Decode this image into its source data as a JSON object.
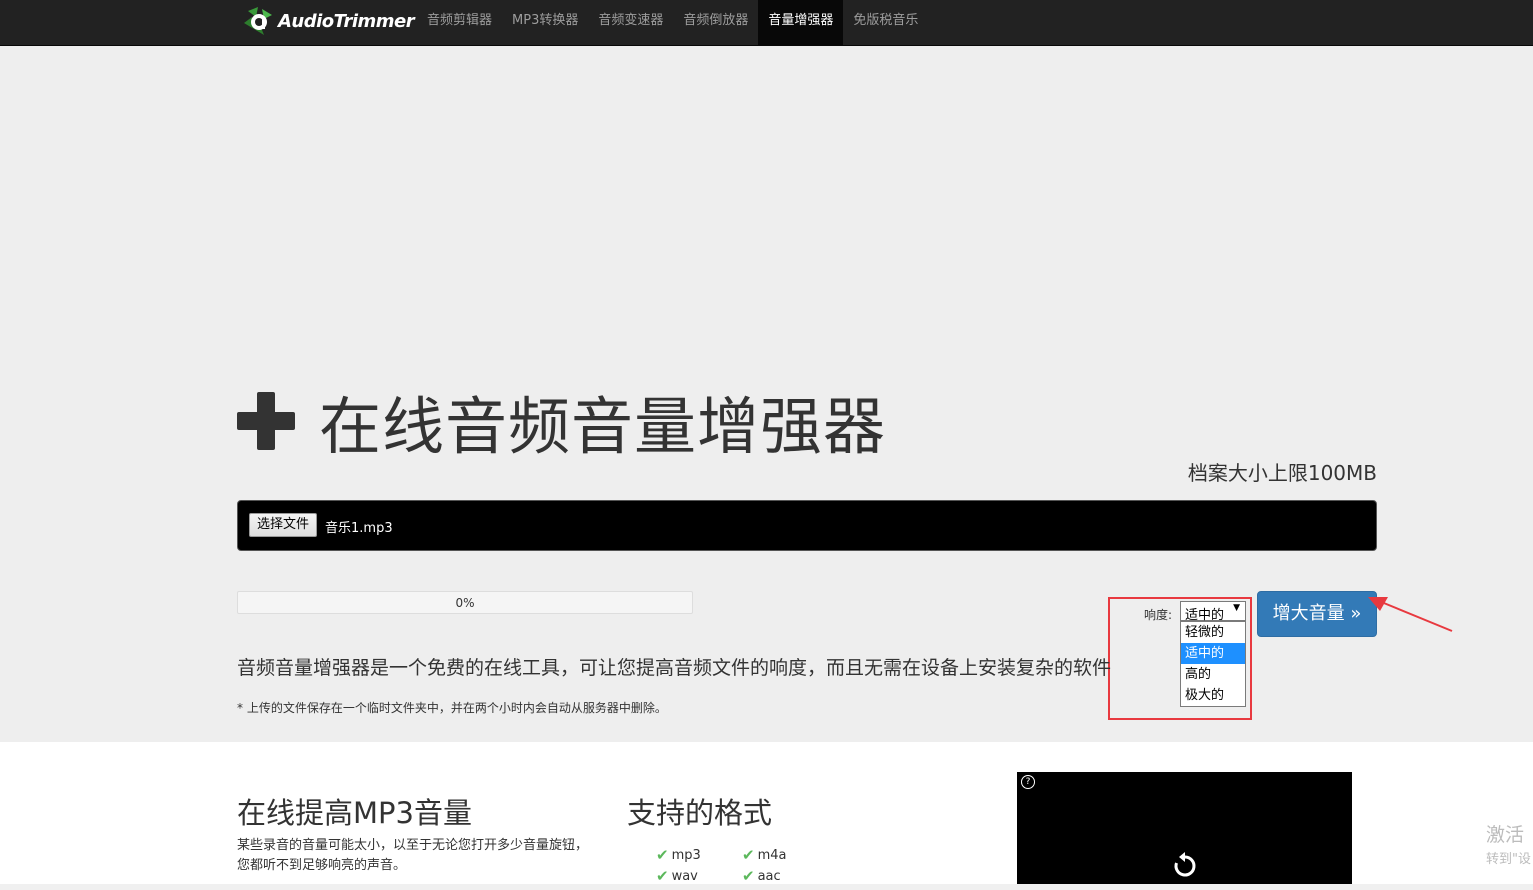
{
  "navbar": {
    "brand": "AudioTrimmer",
    "items": [
      "音频剪辑器",
      "MP3转换器",
      "音频变速器",
      "音频倒放器",
      "音量增强器",
      "免版税音乐"
    ]
  },
  "hero": {
    "title": "在线音频音量增强器",
    "size_limit": "档案大小上限100MB",
    "choose_file_label": "选择文件",
    "file_name": "音乐1.mp3",
    "progress_text": "0%",
    "progress_value": 0,
    "loudness_label": "响度:",
    "loudness_selected": "适中的",
    "loudness_options": [
      "轻微的",
      "适中的",
      "高的",
      "极大的"
    ],
    "boost_button": "增大音量 »",
    "description": "音频音量增强器是一个免费的在线工具，可让您提高音频文件的响度，而且无需在设备上安装复杂的软件",
    "note": "* 上传的文件保存在一个临时文件夹中，并在两个小时内会自动从服务器中删除。"
  },
  "section1": {
    "title": "在线提高MP3音量",
    "text": "某些录音的音量可能太小，以至于无论您打开多少音量旋钮，您都听不到足够响亮的声音。"
  },
  "section2": {
    "title": "支持的格式",
    "formats": [
      "mp3",
      "m4a",
      "wav",
      "aac"
    ]
  },
  "watermark": {
    "line1": "激活",
    "line2": "转到\"设"
  },
  "colors": {
    "accent": "#337ab7",
    "highlight": "#e8393f",
    "check": "#5cb85c",
    "nav_bg": "#222222"
  },
  "icons": {
    "plus": "plus-icon",
    "check": "check-icon",
    "replay": "replay-icon",
    "help": "help-icon",
    "caret": "caret-down-icon"
  }
}
